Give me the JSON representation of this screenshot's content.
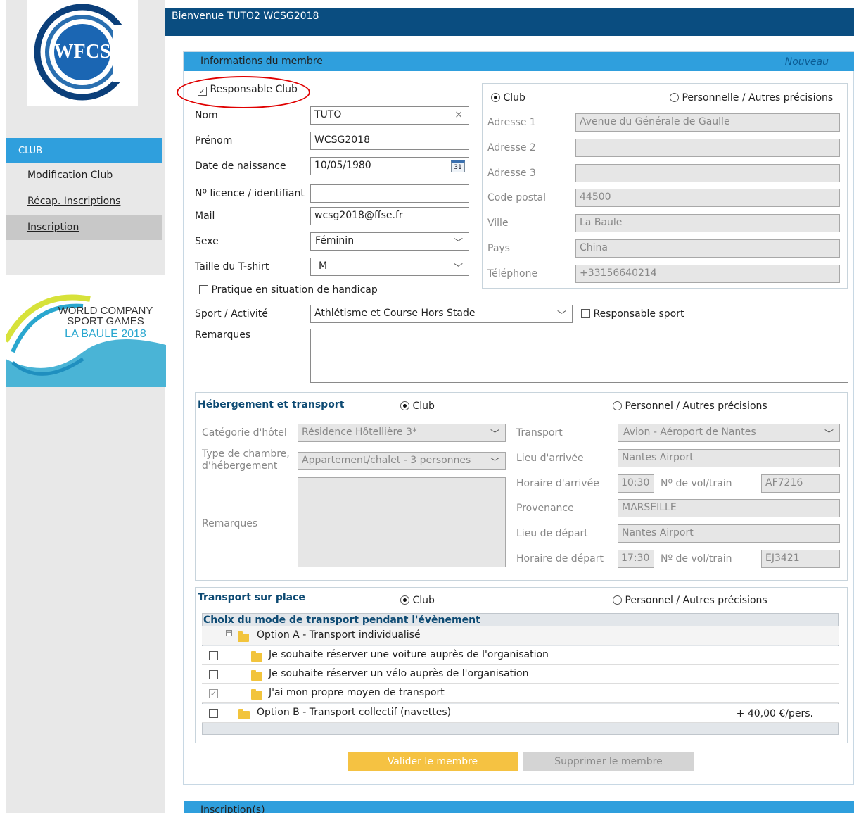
{
  "header": {
    "welcome": "Bienvenue TUTO2 WCSG2018"
  },
  "logo": {
    "text": "WFCS"
  },
  "sidebar": {
    "section": "CLUB",
    "items": [
      {
        "label": "Modification Club"
      },
      {
        "label": "Récap. Inscriptions"
      },
      {
        "label": "Inscription"
      }
    ]
  },
  "event_logo": {
    "line1": "WORLD COMPANY",
    "line2": "SPORT GAMES",
    "line3": "LA BAULE 2018"
  },
  "card": {
    "title": "Informations du membre",
    "status": "Nouveau"
  },
  "form": {
    "responsable_club": "Responsable Club",
    "nom_label": "Nom",
    "nom_value": "TUTO",
    "prenom_label": "Prénom",
    "prenom_value": "WCSG2018",
    "naissance_label": "Date de naissance",
    "naissance_value": "10/05/1980",
    "calendar_day": "31",
    "licence_label": "Nº licence / identifiant",
    "licence_value": "",
    "mail_label": "Mail",
    "mail_value": "wcsg2018@ffse.fr",
    "sexe_label": "Sexe",
    "sexe_value": "Féminin",
    "tshirt_label": "Taille du T-shirt",
    "tshirt_value": "M",
    "handicap_label": "Pratique en situation de handicap",
    "sport_label": "Sport / Activité",
    "sport_value": "Athlétisme et Course Hors Stade",
    "resp_sport_label": "Responsable sport",
    "remarques_label": "Remarques"
  },
  "address": {
    "opt_club": "Club",
    "opt_perso": "Personnelle / Autres précisions",
    "fields": [
      {
        "label": "Adresse 1",
        "value": "Avenue du Générale de Gaulle"
      },
      {
        "label": "Adresse 2",
        "value": ""
      },
      {
        "label": "Adresse 3",
        "value": ""
      },
      {
        "label": "Code postal",
        "value": "44500"
      },
      {
        "label": "Ville",
        "value": "La Baule"
      },
      {
        "label": "Pays",
        "value": "China"
      },
      {
        "label": "Téléphone",
        "value": "+33156640214"
      }
    ]
  },
  "hebergement": {
    "title": "Hébergement et transport",
    "opt_club": "Club",
    "opt_perso": "Personnel / Autres précisions",
    "hotel_label": "Catégorie d'hôtel",
    "hotel_value": "Résidence Hôtellière 3*",
    "chambre_label1": "Type de chambre,",
    "chambre_label2": "d'hébergement",
    "chambre_value": "Appartement/chalet - 3 personnes",
    "remarques_label": "Remarques",
    "transport_label": "Transport",
    "transport_value": "Avion - Aéroport de Nantes",
    "arrivee_lieu_label": "Lieu d'arrivée",
    "arrivee_lieu_value": "Nantes Airport",
    "arrivee_heure_label": "Horaire d'arrivée",
    "arrivee_heure_value": "10:30",
    "vol_label": "Nº de vol/train",
    "vol_arrivee": "AF7216",
    "provenance_label": "Provenance",
    "provenance_value": "MARSEILLE",
    "depart_lieu_label": "Lieu de départ",
    "depart_lieu_value": "Nantes Airport",
    "depart_heure_label": "Horaire de départ",
    "depart_heure_value": "17:30",
    "vol_depart": "EJ3421"
  },
  "transport_place": {
    "title": "Transport sur place",
    "opt_club": "Club",
    "opt_perso": "Personnel / Autres précisions",
    "grid_title": "Choix du mode de transport pendant l'évènement",
    "option_a": "Option A - Transport individualisé",
    "items": [
      {
        "label": "Je souhaite réserver une voiture auprès de l'organisation",
        "checked": "false"
      },
      {
        "label": "Je souhaite réserver un vélo auprès de l'organisation",
        "checked": "false"
      },
      {
        "label": "J'ai mon propre moyen de transport",
        "checked": "true"
      }
    ],
    "option_b": "Option B - Transport collectif (navettes)",
    "option_b_price": "+ 40,00 €/pers."
  },
  "buttons": {
    "valider": "Valider le membre",
    "supprimer": "Supprimer le membre"
  },
  "inscriptions": {
    "title": "Inscription(s)"
  },
  "colors": {
    "brand_dark": "#0a4d80",
    "brand": "#2f9fdd",
    "validate": "#f5c242",
    "delete": "#c8c8c8",
    "highlight": "#e00000"
  }
}
